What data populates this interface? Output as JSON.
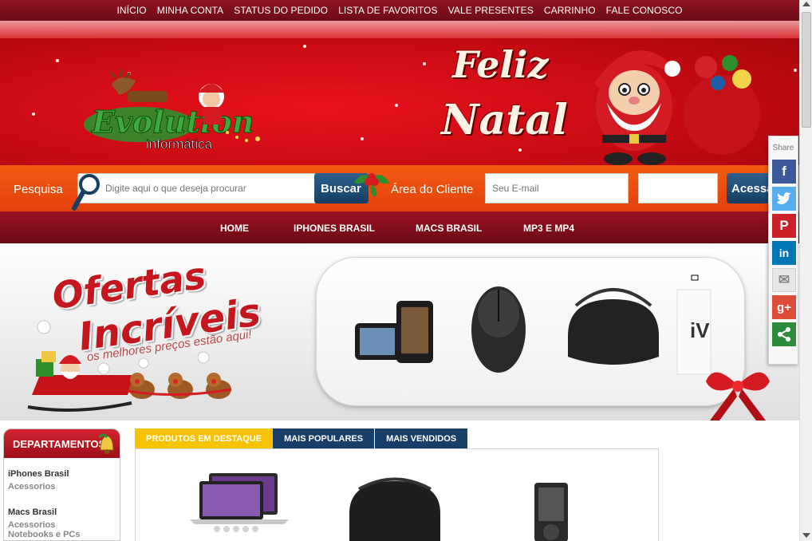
{
  "topnav": {
    "items": [
      "INÍCIO",
      "MINHA CONTA",
      "STATUS DO PEDIDO",
      "LISTA DE FAVORITOS",
      "VALE PRESENTES",
      "CARRINHO",
      "FALE CONOSCO"
    ]
  },
  "banner": {
    "logo_text": "Evolution",
    "logo_sub": "informática",
    "greeting_line1": "Feliz",
    "greeting_line2": "Natal"
  },
  "search": {
    "label": "Pesquisa",
    "placeholder": "Digite aqui o que deseja procurar",
    "button_label": "Buscar"
  },
  "client_area": {
    "label": "Área do Cliente",
    "email_placeholder": "Seu E-mail",
    "login_button": "Acessar"
  },
  "mainnav": {
    "items": [
      "HOME",
      "IPHONES BRASIL",
      "MACS BRASIL",
      "MP3 E MP4"
    ]
  },
  "promo": {
    "title_line1": "Ofertas",
    "title_line2": "Incríveis",
    "tagline": "os melhores preços estão aqui!"
  },
  "departments": {
    "heading": "DEPARTAMENTOS",
    "groups": [
      {
        "title": "iPhones Brasil",
        "subs": [
          "Acessorios"
        ]
      },
      {
        "title": "Macs Brasil",
        "subs": [
          "Acessorios",
          "Notebooks e PCs"
        ]
      }
    ]
  },
  "product_tabs": {
    "tabs": [
      "PRODUTOS EM DESTAQUE",
      "MAIS POPULARES",
      "MAIS VENDIDOS"
    ],
    "active": 0
  },
  "share": {
    "label": "Share",
    "buttons": [
      {
        "name": "facebook",
        "glyph": "f",
        "color": "#3b5998"
      },
      {
        "name": "twitter",
        "glyph": "t",
        "color": "#55acee"
      },
      {
        "name": "pinterest",
        "glyph": "P",
        "color": "#cb2027"
      },
      {
        "name": "linkedin",
        "glyph": "in",
        "color": "#0077b5"
      },
      {
        "name": "email",
        "glyph": "✉",
        "color": "#e6e6e6"
      },
      {
        "name": "google-plus",
        "glyph": "g+",
        "color": "#dd4b39"
      },
      {
        "name": "share",
        "glyph": "⤷",
        "color": "#2d8c3c"
      }
    ]
  },
  "colors": {
    "topnav": "#8e1420",
    "banner_red": "#c60a12",
    "search_orange": "#f25a12",
    "button_blue": "#173e63",
    "tab_active": "#f7c300",
    "tab_dark": "#173f69"
  }
}
